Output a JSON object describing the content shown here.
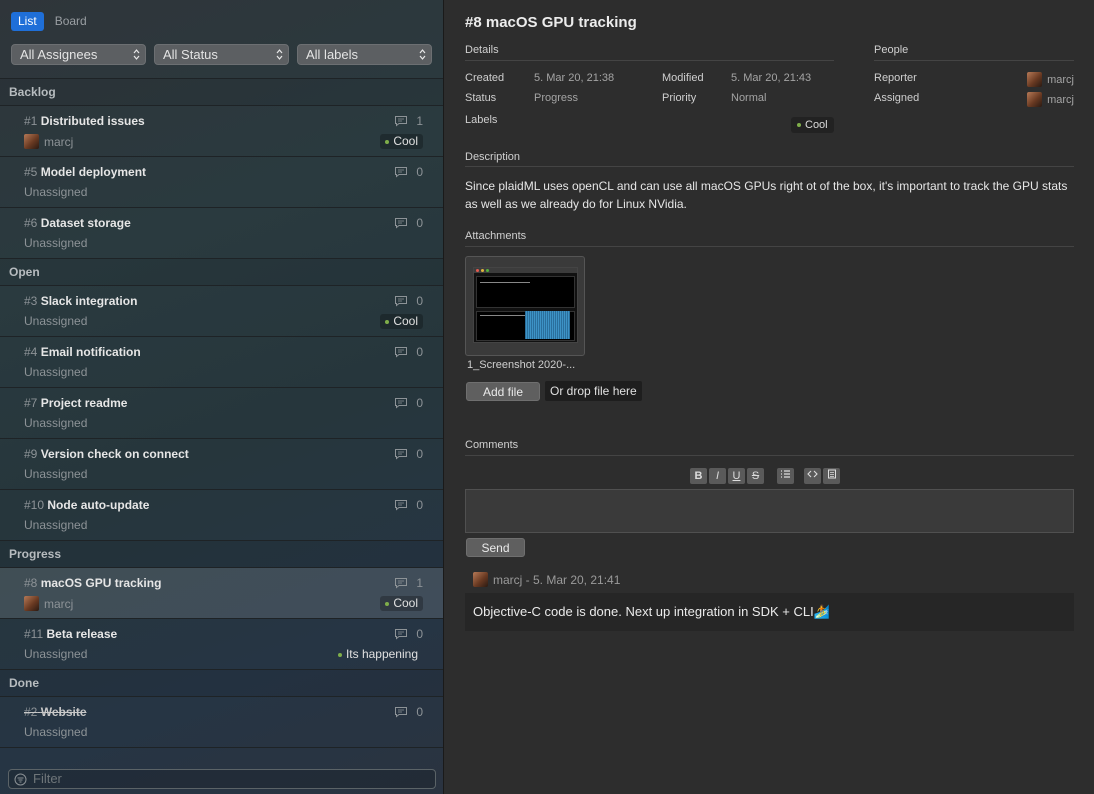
{
  "sidebar": {
    "view_tabs": [
      "List",
      "Board"
    ],
    "filters": [
      "All Assignees",
      "All Status",
      "All labels"
    ],
    "filter_placeholder": "Filter",
    "sections": [
      {
        "name": "Backlog",
        "issues": [
          {
            "num": "#1",
            "title": "Distributed issues",
            "comments": "1",
            "assignee": "marcj",
            "has_avatar": true,
            "tag": "Cool"
          },
          {
            "num": "#5",
            "title": "Model deployment",
            "comments": "0",
            "assignee": "Unassigned",
            "has_avatar": false,
            "tag": ""
          },
          {
            "num": "#6",
            "title": "Dataset storage",
            "comments": "0",
            "assignee": "Unassigned",
            "has_avatar": false,
            "tag": ""
          }
        ]
      },
      {
        "name": "Open",
        "issues": [
          {
            "num": "#3",
            "title": "Slack integration",
            "comments": "0",
            "assignee": "Unassigned",
            "has_avatar": false,
            "tag": "Cool"
          },
          {
            "num": "#4",
            "title": "Email notification",
            "comments": "0",
            "assignee": "Unassigned",
            "has_avatar": false,
            "tag": ""
          },
          {
            "num": "#7",
            "title": "Project readme",
            "comments": "0",
            "assignee": "Unassigned",
            "has_avatar": false,
            "tag": ""
          },
          {
            "num": "#9",
            "title": "Version check on connect",
            "comments": "0",
            "assignee": "Unassigned",
            "has_avatar": false,
            "tag": ""
          },
          {
            "num": "#10",
            "title": "Node auto-update",
            "comments": "0",
            "assignee": "Unassigned",
            "has_avatar": false,
            "tag": ""
          }
        ]
      },
      {
        "name": "Progress",
        "issues": [
          {
            "num": "#8",
            "title": "macOS GPU tracking",
            "comments": "1",
            "assignee": "marcj",
            "has_avatar": true,
            "tag": "Cool",
            "selected": true
          },
          {
            "num": "#11",
            "title": "Beta release",
            "comments": "0",
            "assignee": "Unassigned",
            "has_avatar": false,
            "tag": "Its happening"
          }
        ]
      },
      {
        "name": "Done",
        "issues": [
          {
            "num": "#2",
            "title": "Website",
            "comments": "0",
            "assignee": "Unassigned",
            "has_avatar": false,
            "tag": "",
            "done": true
          }
        ]
      }
    ]
  },
  "detail": {
    "title": "#8 macOS GPU tracking",
    "details_label": "Details",
    "people_label": "People",
    "created_label": "Created",
    "created_value": "5. Mar 20, 21:38",
    "modified_label": "Modified",
    "modified_value": "5. Mar 20, 21:43",
    "status_label": "Status",
    "status_value": "Progress",
    "priority_label": "Priority",
    "priority_value": "Normal",
    "labels_label": "Labels",
    "label_tag": "Cool",
    "reporter_label": "Reporter",
    "reporter_value": "marcj",
    "assigned_label": "Assigned",
    "assigned_value": "marcj",
    "description_label": "Description",
    "description": "Since plaidML uses openCL and can use all macOS GPUs right ot of the box, it's important to track the GPU stats as well as we already do for Linux NVidia.",
    "attachments_label": "Attachments",
    "attachment_name": "1_Screenshot 2020-...",
    "add_file": "Add file",
    "drop_text": "Or drop file here",
    "comments_label": "Comments",
    "send": "Send",
    "comment_author_line": "marcj - 5. Mar 20, 21:41",
    "comment_text": "Objective-C code is done. Next up integration in SDK + CLI🏄",
    "toolbar": [
      "B",
      "I",
      "U",
      "S"
    ]
  }
}
